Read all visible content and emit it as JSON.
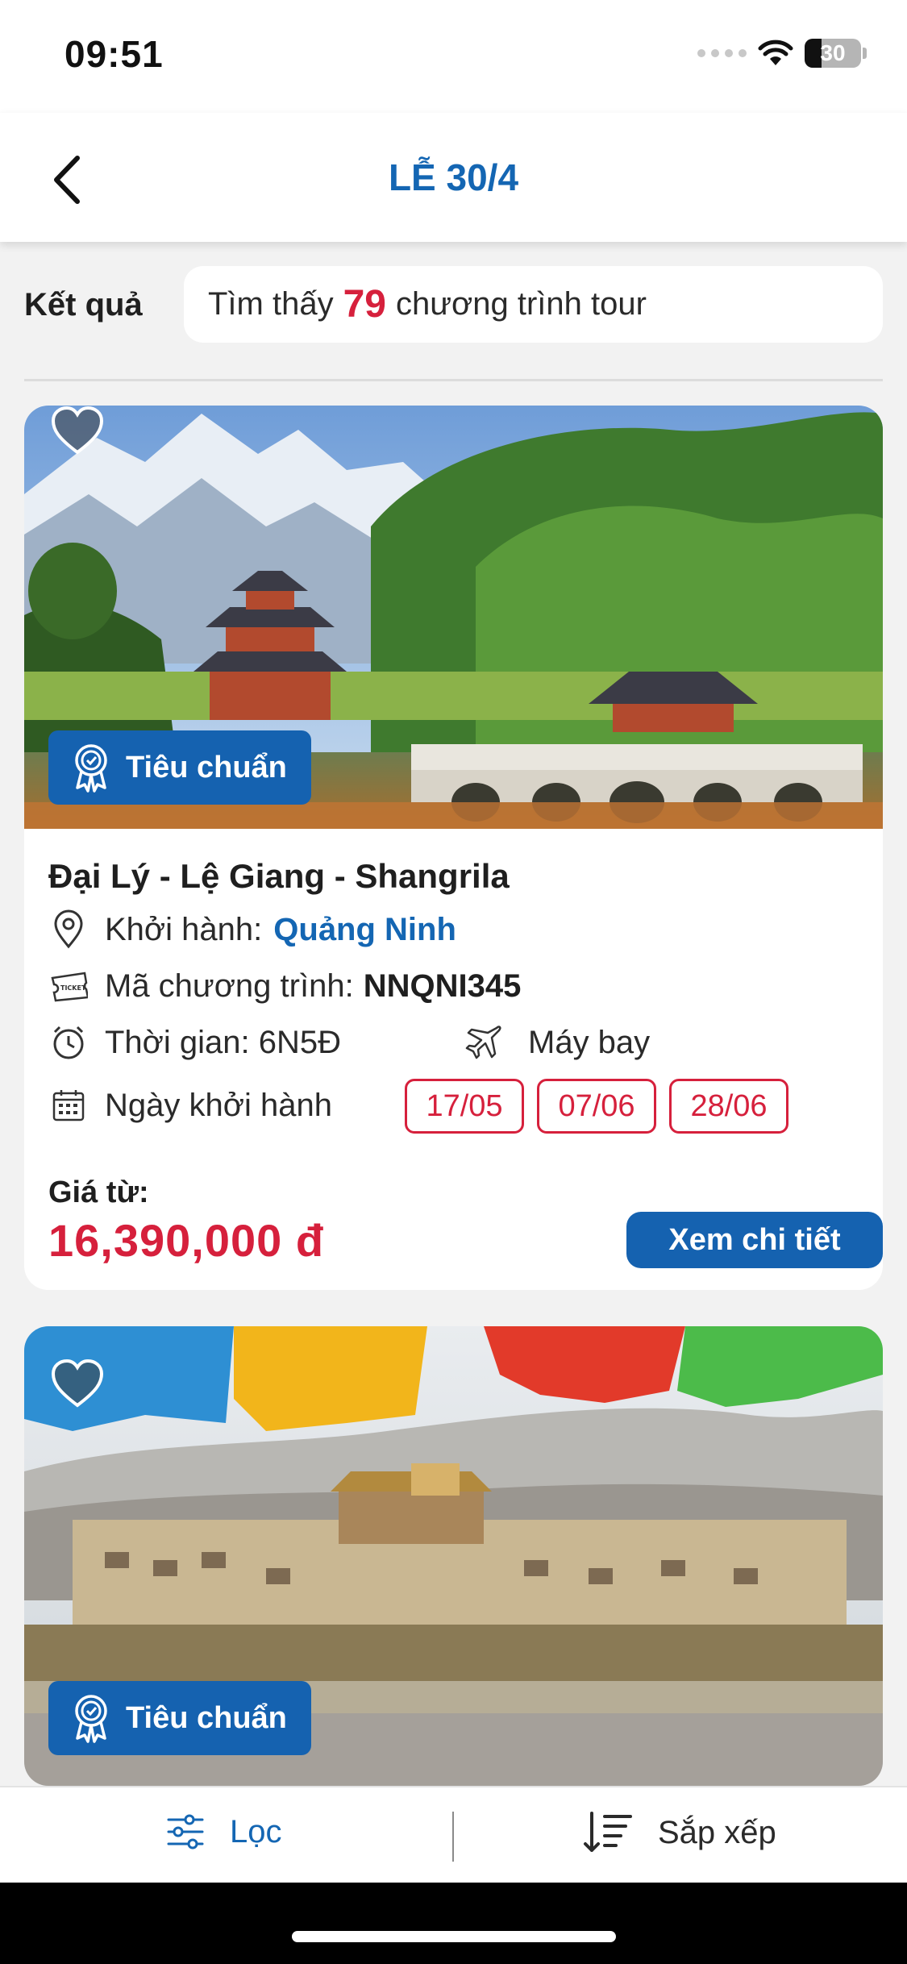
{
  "status_bar": {
    "time": "09:51",
    "battery": "30",
    "battery_level": 0.3
  },
  "header": {
    "title": "LỄ 30/4"
  },
  "results": {
    "label": "Kết quả",
    "prefix": "Tìm thấy",
    "count": "79",
    "suffix": "chương trình tour"
  },
  "tours": [
    {
      "name": "Đại Lý - Lệ Giang - Shangrila",
      "badge": "Tiêu chuẩn",
      "departure_label": "Khởi hành:",
      "departure_value": "Quảng Ninh",
      "code_label": "Mã chương trình:",
      "code_value": "NNQNI345",
      "duration_label": "Thời gian: 6N5Đ",
      "transport": "Máy bay",
      "dates_label": "Ngày khởi hành",
      "dates": [
        "17/05",
        "07/06",
        "28/06"
      ],
      "price_label": "Giá từ:",
      "price": "16,390,000 đ",
      "detail_button": "Xem chi tiết"
    },
    {
      "badge": "Tiêu chuẩn"
    }
  ],
  "bottom_bar": {
    "filter_label": "Lọc",
    "sort_label": "Sắp xếp"
  },
  "colors": {
    "primary": "#1466b3",
    "accent": "#d6203c"
  },
  "icons": [
    "back-icon",
    "heart-icon",
    "award-icon",
    "location-icon",
    "ticket-icon",
    "clock-icon",
    "airplane-icon",
    "calendar-icon",
    "filter-icon",
    "sort-icon",
    "wifi-icon"
  ]
}
